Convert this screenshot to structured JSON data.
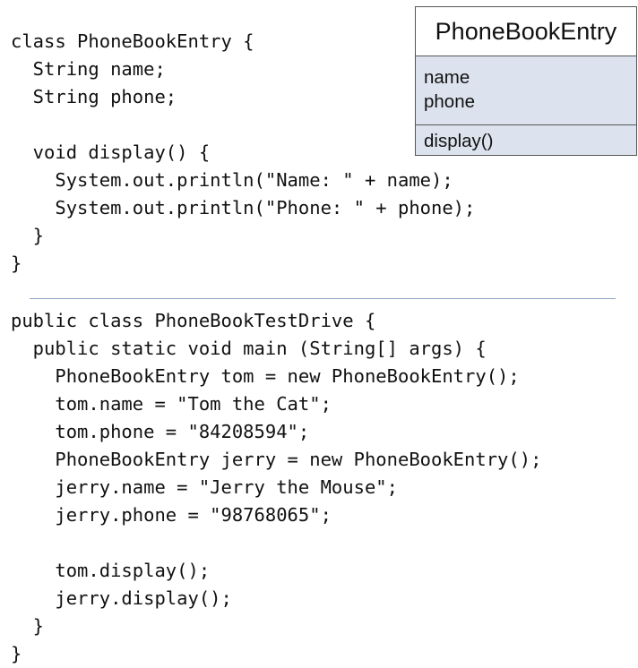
{
  "code_class": [
    "class PhoneBookEntry {",
    "  String name;",
    "  String phone;",
    "",
    "  void display() {",
    "    System.out.println(\"Name: \" + name);",
    "    System.out.println(\"Phone: \" + phone);",
    "  }",
    "}"
  ],
  "code_test": [
    "public class PhoneBookTestDrive {",
    "  public static void main (String[] args) {",
    "    PhoneBookEntry tom = new PhoneBookEntry();",
    "    tom.name = \"Tom the Cat\";",
    "    tom.phone = \"84208594\";",
    "    PhoneBookEntry jerry = new PhoneBookEntry();",
    "    jerry.name = \"Jerry the Mouse\";",
    "    jerry.phone = \"98768065\";",
    "",
    "    tom.display();",
    "    jerry.display();",
    "  }",
    "}"
  ],
  "uml": {
    "class_name": "PhoneBookEntry",
    "attributes": [
      "name",
      "phone"
    ],
    "methods": [
      "display()"
    ]
  },
  "colors": {
    "uml_section_fill": "#dde3ee",
    "divider": "#8ea4c8"
  }
}
